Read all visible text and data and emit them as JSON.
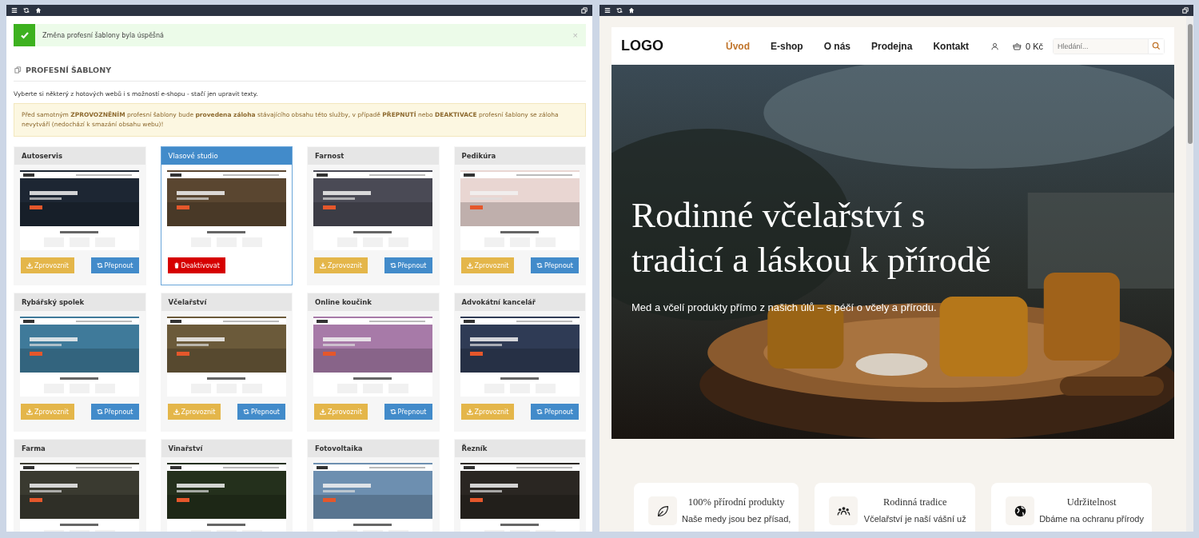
{
  "notice": {
    "text": "Změna profesní šablony byla úspěšná",
    "close": "×"
  },
  "heading": "PROFESNÍ ŠABLONY",
  "intro": "Vyberte si některý z hotových webů i s možností e-shopu - stačí jen upravit texty.",
  "warning": "Před samotným **ZPROVOZNĚNÍM** profesní šablony bude **provedena záloha** stávajícího obsahu této služby, v případě **PŘEPNUTÍ** nebo **DEAKTIVACE** profesní šablony se záloha nevytváří (nedochází k smazání obsahu webu)!",
  "templates": [
    {
      "title": "Autoservis",
      "selected": false,
      "buttons": [
        {
          "kind": "activate",
          "label": "Zprovoznit"
        },
        {
          "kind": "switch",
          "label": "Přepnout"
        }
      ]
    },
    {
      "title": "Vlasové studio",
      "selected": true,
      "buttons": [
        {
          "kind": "deactivate",
          "label": "Deaktivovat"
        }
      ]
    },
    {
      "title": "Farnost",
      "selected": false,
      "buttons": [
        {
          "kind": "activate",
          "label": "Zprovoznit"
        },
        {
          "kind": "switch",
          "label": "Přepnout"
        }
      ]
    },
    {
      "title": "Pedikúra",
      "selected": false,
      "buttons": [
        {
          "kind": "activate",
          "label": "Zprovoznit"
        },
        {
          "kind": "switch",
          "label": "Přepnout"
        }
      ]
    },
    {
      "title": "Rybářský spolek",
      "selected": false,
      "buttons": [
        {
          "kind": "activate",
          "label": "Zprovoznit"
        },
        {
          "kind": "switch",
          "label": "Přepnout"
        }
      ]
    },
    {
      "title": "Včelařství",
      "selected": false,
      "buttons": [
        {
          "kind": "activate",
          "label": "Zprovoznit"
        },
        {
          "kind": "switch",
          "label": "Přepnout"
        }
      ]
    },
    {
      "title": "Online koučink",
      "selected": false,
      "buttons": [
        {
          "kind": "activate",
          "label": "Zprovoznit"
        },
        {
          "kind": "switch",
          "label": "Přepnout"
        }
      ]
    },
    {
      "title": "Advokátní kancelář",
      "selected": false,
      "buttons": [
        {
          "kind": "activate",
          "label": "Zprovoznit"
        },
        {
          "kind": "switch",
          "label": "Přepnout"
        }
      ]
    },
    {
      "title": "Farma",
      "selected": false
    },
    {
      "title": "Vinařství",
      "selected": false
    },
    {
      "title": "Fotovoltaika",
      "selected": false
    },
    {
      "title": "Řezník",
      "selected": false
    }
  ],
  "preview": {
    "logo": "LOGO",
    "nav": [
      {
        "label": "Úvod",
        "selected": true
      },
      {
        "label": "E-shop",
        "selected": false
      },
      {
        "label": "O nás",
        "selected": false
      },
      {
        "label": "Prodejna",
        "selected": false
      },
      {
        "label": "Kontakt",
        "selected": false
      }
    ],
    "cart": "0 Kč",
    "search": {
      "placeholder": "Hledání..."
    },
    "hero": {
      "title": "Rodinné včelařství s tradicí a láskou k přírodě",
      "subtitle": "Med a včelí produkty přímo z našich úlů – s péčí o včely a přírodu."
    },
    "features": [
      {
        "title": "100% přírodní produkty",
        "text": "Naše medy jsou bez přísad,"
      },
      {
        "title": "Rodinná tradice",
        "text": "Včelařství je naší vášní už"
      },
      {
        "title": "Udržitelnost",
        "text": "Dbáme na ochranu přírody"
      }
    ]
  }
}
